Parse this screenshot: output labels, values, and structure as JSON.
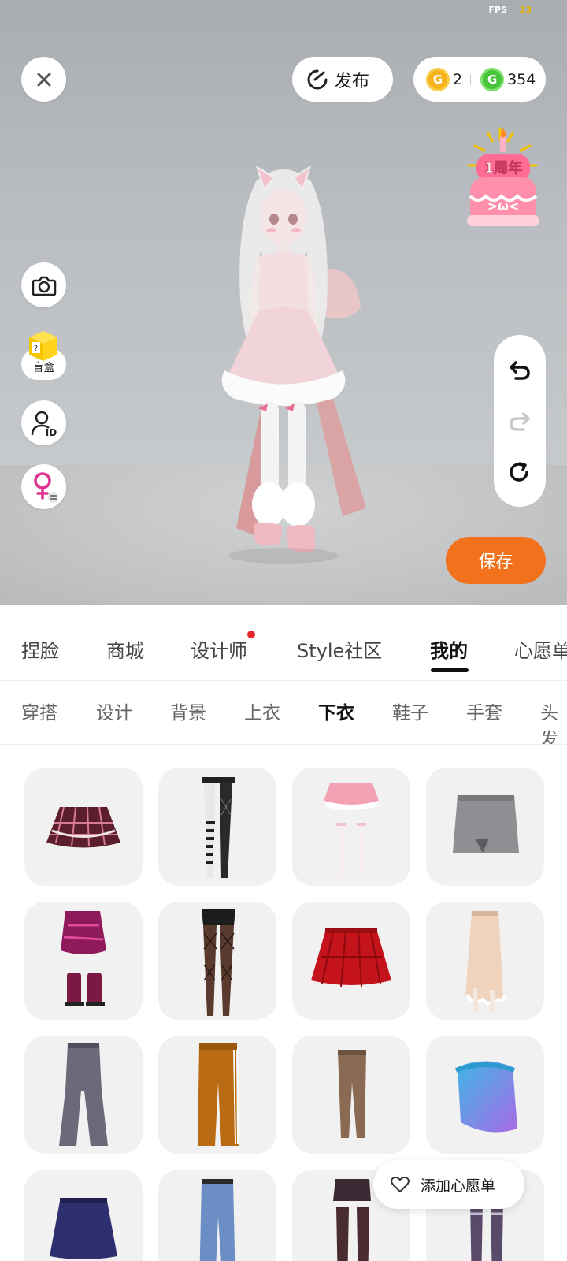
{
  "status": {
    "fps_label": "FPS",
    "fps_value": "23"
  },
  "top_bar": {
    "close_icon": "close-icon",
    "publish_label": "发布",
    "gold_coin_count": "2",
    "green_coin_count": "354"
  },
  "left_tools": {
    "camera_icon": "camera-icon",
    "mystery_box_label": "盲盒",
    "profile_id_icon": "profile-id-icon",
    "gender_icon": "female-swap-icon"
  },
  "anniversary_badge": {
    "text": "1周年",
    "face": ">ω<"
  },
  "right_tools": {
    "undo": "undo-icon",
    "redo": "redo-icon",
    "reset": "reset-icon"
  },
  "save_label": "保存",
  "main_tabs": [
    {
      "label": "捏脸",
      "active": false
    },
    {
      "label": "商城",
      "active": false
    },
    {
      "label": "设计师",
      "active": false,
      "badge": true
    },
    {
      "label": "Style社区",
      "active": false
    },
    {
      "label": "我的",
      "active": true
    },
    {
      "label": "心愿单",
      "active": false
    }
  ],
  "sub_tabs": [
    {
      "label": "穿搭",
      "active": false
    },
    {
      "label": "设计",
      "active": false
    },
    {
      "label": "背景",
      "active": false
    },
    {
      "label": "上衣",
      "active": false
    },
    {
      "label": "下衣",
      "active": true
    },
    {
      "label": "鞋子",
      "active": false
    },
    {
      "label": "手套",
      "active": false
    },
    {
      "label": "头发",
      "active": false
    }
  ],
  "items": [
    "plaid-pleated-skirt-dark-red",
    "fishnet-striped-leggings",
    "pink-ruffle-skirt-white-socks",
    "grey-mini-skirt",
    "magenta-layered-skirt-boots",
    "fishnet-tights-black-shorts",
    "red-plaid-pleated-skirt",
    "beige-lace-long-skirt",
    "grey-flared-pants",
    "orange-track-pants",
    "brown-leggings",
    "blue-gradient-wrap-skirt",
    "navy-flared-skirt",
    "blue-denim-jeans",
    "shorts-with-brown-stockings",
    "striped-stockings"
  ],
  "wishlist_label": "添加心愿单",
  "colors": {
    "accent_orange": "#f2711c",
    "badge_red": "#e8262a",
    "gold": "#f5b21a",
    "green": "#48c43c"
  }
}
